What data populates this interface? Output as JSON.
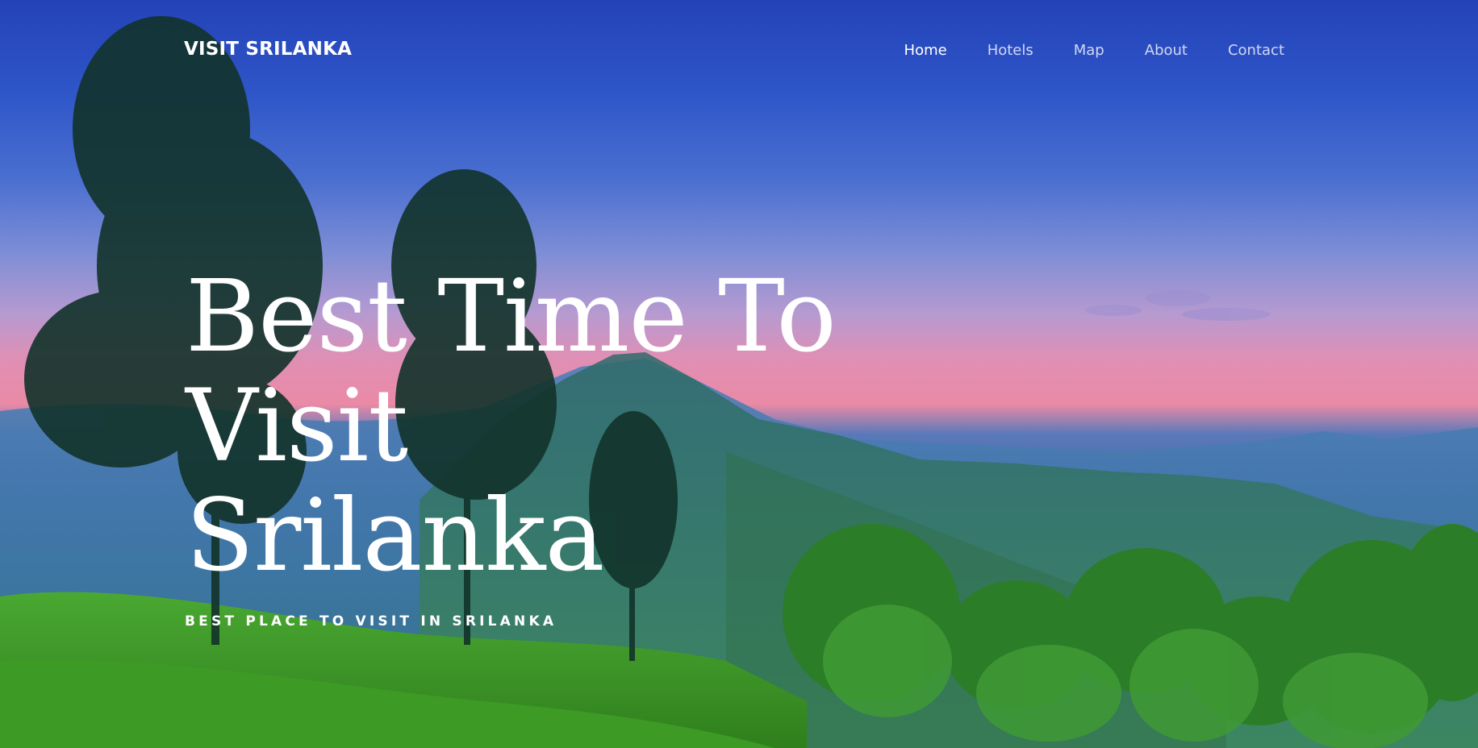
{
  "brand": {
    "name": "VISIT SRILANKA"
  },
  "nav": {
    "items": [
      {
        "label": "Home",
        "active": true
      },
      {
        "label": "Hotels",
        "active": false
      },
      {
        "label": "Map",
        "active": false
      },
      {
        "label": "About",
        "active": false
      },
      {
        "label": "Contact",
        "active": false
      }
    ]
  },
  "hero": {
    "headline_lines": [
      "Best Time To",
      "Visit",
      "Srilanka"
    ],
    "subline": "BEST PLACE TO VISIT IN SRILANKA"
  },
  "colors": {
    "sky_top": "#2442b8",
    "sky_glow": "#e08fb4",
    "mountains": "#3f6aa8",
    "foliage": "#3f9a2c",
    "text": "#ffffff"
  }
}
